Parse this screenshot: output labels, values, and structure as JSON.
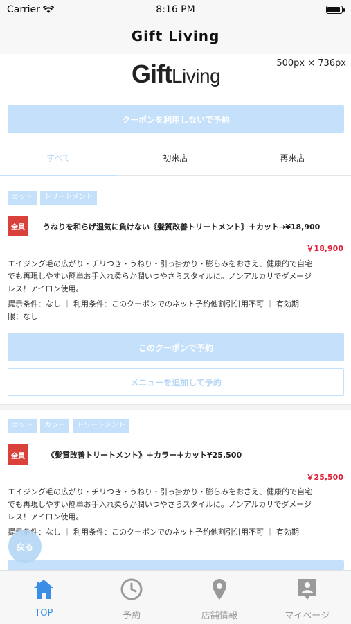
{
  "status_bar": {
    "carrier": "Carrier",
    "time": "8:16 PM"
  },
  "nav": {
    "title": "Gift Living"
  },
  "logo": {
    "gift": "Gift",
    "living": "Living"
  },
  "dims_label": "500px × 736px",
  "no_coupon_button": "クーポンを利用しないで予約",
  "tabs": [
    {
      "label": "すべて",
      "active": true
    },
    {
      "label": "初来店",
      "active": false
    },
    {
      "label": "再来店",
      "active": false
    }
  ],
  "coupons": [
    {
      "tags": [
        "カット",
        "トリートメント"
      ],
      "badge": "全員",
      "title": "うねりを和らげ湿気に負けない《髪質改善トリートメント》＋カット→¥18,900",
      "price": "￥18,900",
      "desc_lines": [
        "エイジング毛の広がり・チリつき・うねり・引っ掛かり・膨らみをおさえ、健康的で自宅",
        "でも再現しやすい簡単お手入れ柔らか潤いつやさらスタイルに。ノンアルカリでダメージ",
        "レス！アイロン使用。"
      ],
      "terms_lines": [
        "提示条件：なし ｜ 利用条件：このクーポンでのネット予約他割引併用不可 ｜ 有効期",
        "限：なし"
      ],
      "reserve_button": "このクーポンで予約",
      "add_menu_button": "メニューを追加して予約"
    },
    {
      "tags": [
        "カット",
        "カラー",
        "トリートメント"
      ],
      "badge": "全員",
      "title": "《髪質改善トリートメント》＋カラー＋カット¥25,500",
      "price": "￥25,500",
      "desc_lines": [
        "エイジング毛の広がり・チリつき・うねり・引っ掛かり・膨らみをおさえ、健康的で自宅",
        "でも再現しやすい簡単お手入れ柔らか潤いつやさらスタイルに。ノンアルカリでダメージ",
        "レス！アイロン使用。"
      ],
      "terms_lines": [
        "提示条件：なし ｜ 利用条件：このクーポンでのネット予約他割引併用不可 ｜ 有効期"
      ]
    }
  ],
  "back_button": "戻る",
  "tabbar": [
    {
      "label": "TOP",
      "icon": "home-icon",
      "active": true
    },
    {
      "label": "予約",
      "icon": "clock-icon",
      "active": false
    },
    {
      "label": "店舗情報",
      "icon": "map-pin-icon",
      "active": false
    },
    {
      "label": "マイページ",
      "icon": "profile-icon",
      "active": false
    }
  ],
  "colors": {
    "accent": "#c4e0fa",
    "price": "#e0203a",
    "badge": "#d9413a",
    "tab_active": "#3a8ee6"
  }
}
